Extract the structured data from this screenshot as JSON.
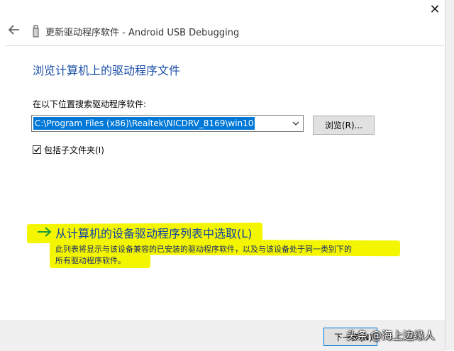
{
  "window": {
    "close_glyph": "✕",
    "title": "更新驱动程序软件 - Android USB Debugging"
  },
  "heading": "浏览计算机上的驱动程序文件",
  "search": {
    "label": "在以下位置搜索驱动程序软件:",
    "path_value": "C:\\Program Files (x86)\\Realtek\\NICDRV_8169\\win10",
    "browse_label": "浏览(R)..."
  },
  "include_subfolders": {
    "checked": true,
    "label": "包括子文件夹(I)"
  },
  "pick_from_list": {
    "arrow": "→",
    "link": "从计算机的设备驱动程序列表中选取(L)",
    "desc_line1": "此列表将显示与该设备兼容的已安装的驱动程序软件，以及与该设备处于同一类别下的",
    "desc_line2": "所有驱动程序软件。"
  },
  "footer": {
    "next_label": "下一步(N)"
  },
  "watermark": "头条 @海上边缘人",
  "colors": {
    "heading": "#1a4ea8",
    "selection": "#0078d7",
    "highlight": "#f4f600"
  },
  "icons": {
    "back": "back-arrow-icon",
    "usb": "usb-device-icon",
    "dropdown": "chevron-down-icon",
    "checkbox": "check-icon",
    "arrow": "green-right-arrow-icon"
  }
}
